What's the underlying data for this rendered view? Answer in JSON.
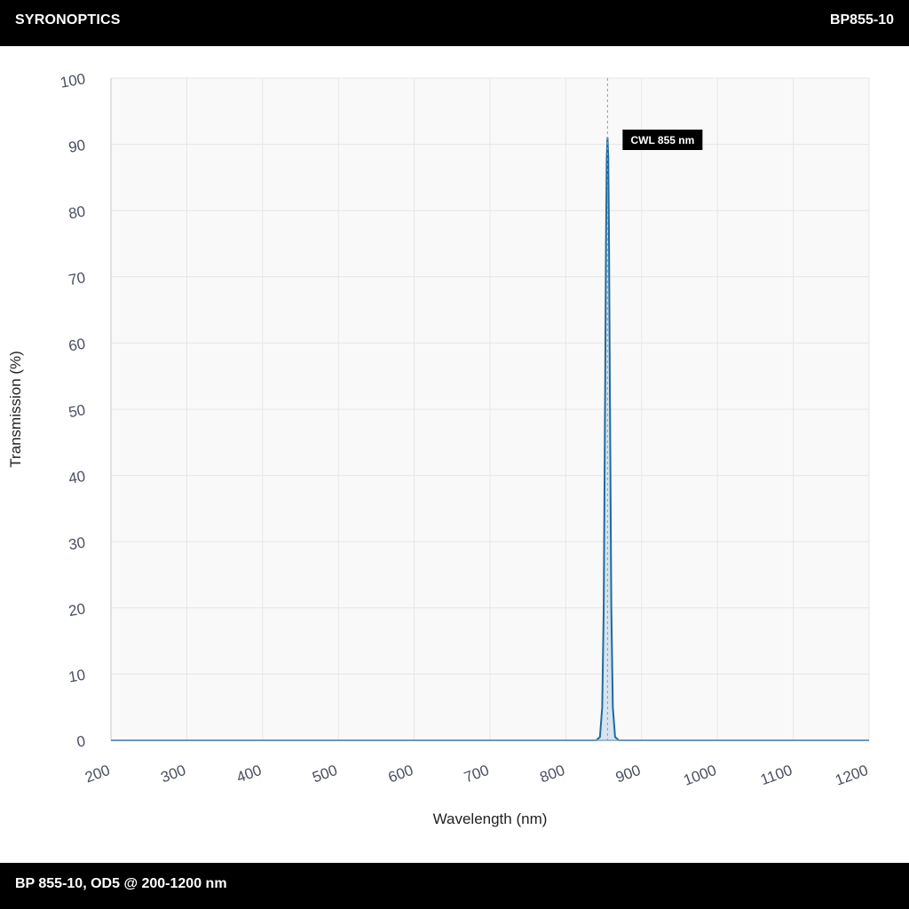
{
  "header": {
    "brand": "SYRONOPTICS",
    "model": "BP855-10"
  },
  "footer": {
    "caption": "BP 855-10, OD5 @ 200-1200 nm"
  },
  "colors": {
    "line": "#1f6a9e",
    "fill": "#cfe0ee",
    "plot_bg": "#f9f9f9",
    "grid": "#e6e6e6",
    "marker": "#9a9a9a"
  },
  "chart_data": {
    "type": "line",
    "xlabel": "Wavelength (nm)",
    "ylabel": "Transmission (%)",
    "xlim": [
      200,
      1200
    ],
    "ylim": [
      0,
      100
    ],
    "x_ticks": [
      200,
      300,
      400,
      500,
      600,
      700,
      800,
      900,
      1000,
      1100,
      1200
    ],
    "y_ticks": [
      0,
      10,
      20,
      30,
      40,
      50,
      60,
      70,
      80,
      90,
      100
    ],
    "grid": true,
    "series": [
      {
        "x": [
          200,
          840,
          845,
          848,
          850,
          852,
          853,
          854,
          855,
          856,
          857,
          858,
          860,
          862,
          865,
          870,
          1200
        ],
        "y": [
          0,
          0,
          0.5,
          5,
          20,
          55,
          75,
          88,
          91,
          88,
          75,
          55,
          20,
          5,
          0.5,
          0,
          0
        ]
      }
    ],
    "annotations": [
      {
        "x": 855,
        "label": "CWL 855 nm"
      }
    ]
  }
}
